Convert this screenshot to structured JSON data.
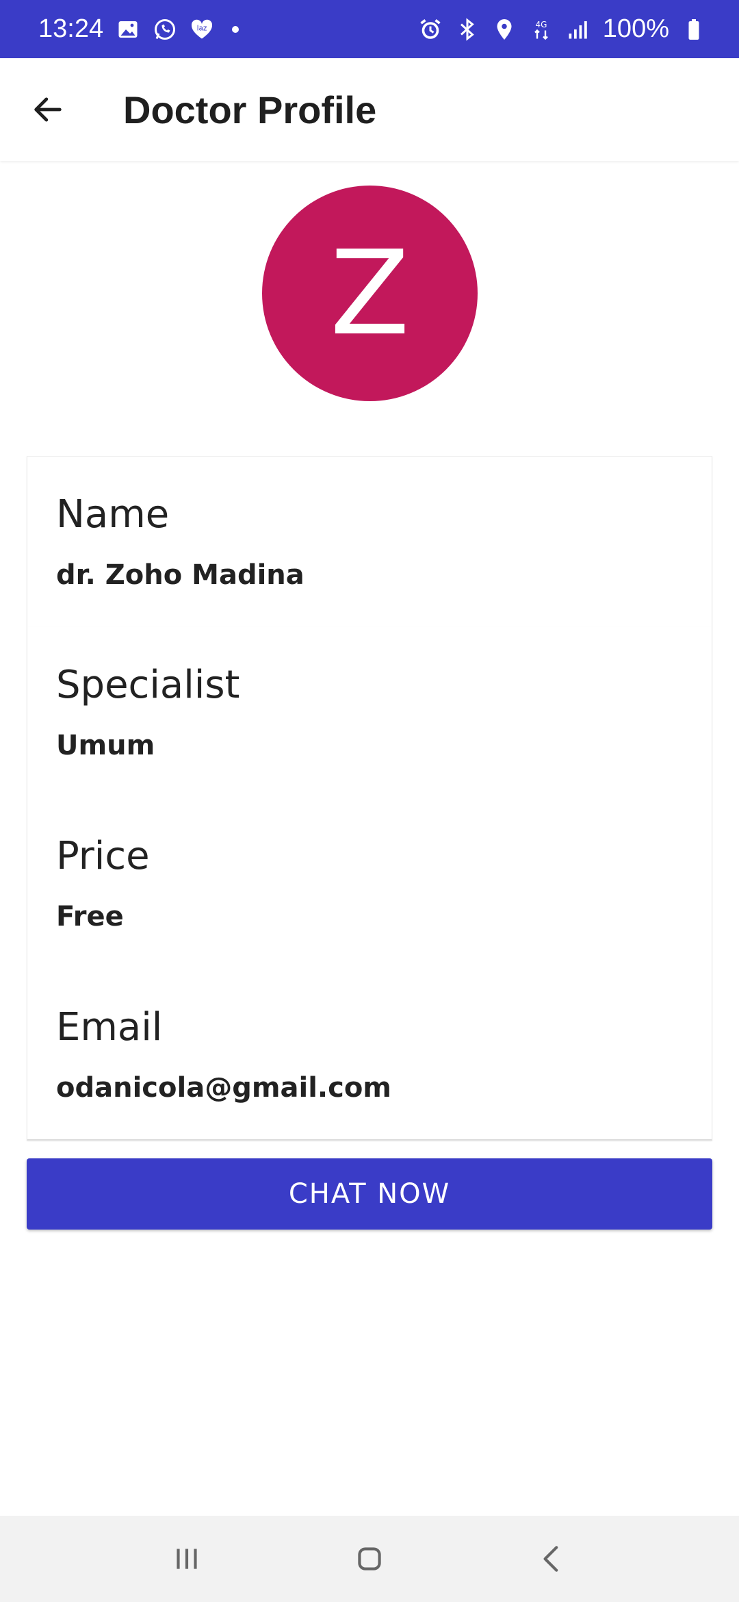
{
  "status_bar": {
    "time": "13:24",
    "battery": "100%",
    "icons_left": [
      "gallery-icon",
      "whatsapp-icon",
      "lazada-icon",
      "dot"
    ],
    "icons_right": [
      "alarm-icon",
      "bluetooth-icon",
      "location-icon",
      "network-4g-icon",
      "signal-icon",
      "battery-icon"
    ],
    "color": "#3a3cc7"
  },
  "app_bar": {
    "title": "Doctor Profile",
    "back_icon": "arrow-left-icon"
  },
  "avatar": {
    "initial": "Z",
    "color": "#c2185b"
  },
  "profile": {
    "name_label": "Name",
    "name_value": "dr. Zoho Madina",
    "specialist_label": "Specialist",
    "specialist_value": "Umum",
    "price_label": "Price",
    "price_value": "Free",
    "email_label": "Email",
    "email_value": "odanicola@gmail.com"
  },
  "chat_button": {
    "label": "CHAT NOW",
    "color": "#3a3cc7"
  },
  "nav_bar": {
    "icons": [
      "recent-apps-icon",
      "home-icon",
      "back-icon"
    ]
  }
}
